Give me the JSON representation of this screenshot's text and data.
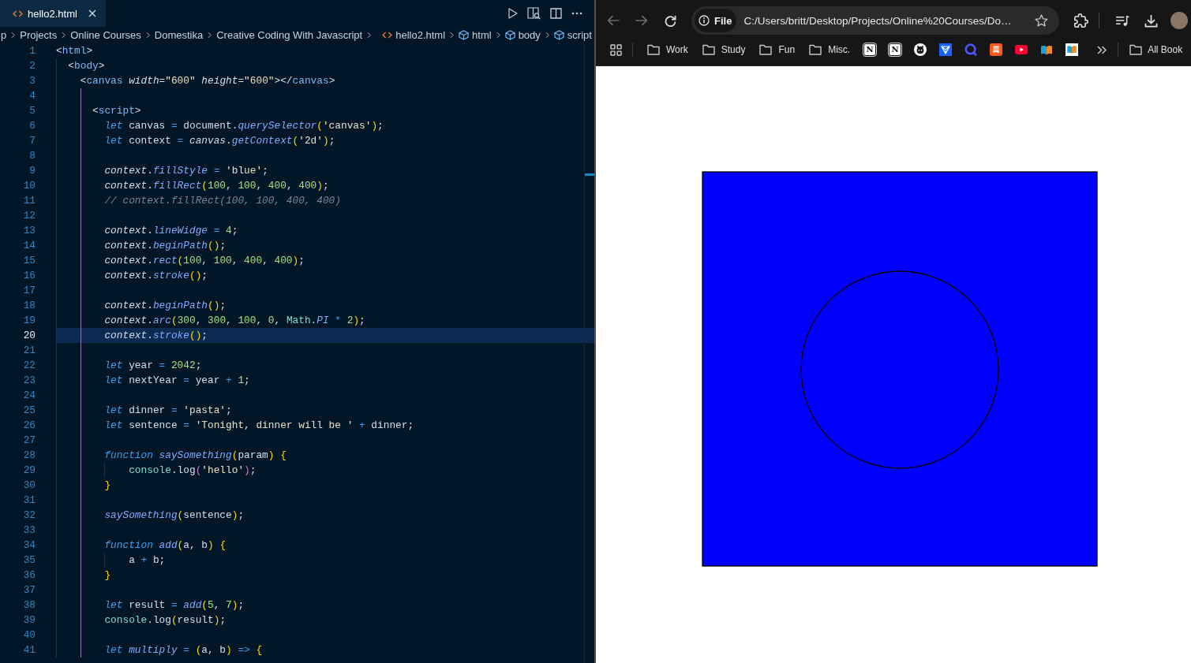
{
  "editor": {
    "tabs": [
      {
        "label": "hello2.html",
        "selected": true
      }
    ],
    "breadcrumbs": [
      {
        "kind": "folder",
        "label": "p"
      },
      {
        "kind": "folder",
        "label": "Projects"
      },
      {
        "kind": "folder",
        "label": "Online Courses"
      },
      {
        "kind": "folder",
        "label": "Domestika"
      },
      {
        "kind": "folder",
        "label": "Creative Coding With Javascript"
      },
      {
        "kind": "file",
        "label": "hello2.html"
      },
      {
        "kind": "symbol",
        "label": "html"
      },
      {
        "kind": "symbol",
        "label": "body"
      },
      {
        "kind": "symbol",
        "label": "script"
      }
    ],
    "lines": [
      {
        "number": "1",
        "current": false,
        "tokens": [
          {
            "kind": "text",
            "text": "<"
          },
          {
            "kind": "tag",
            "text": "html"
          },
          {
            "kind": "text",
            "text": ">"
          }
        ]
      },
      {
        "number": "2",
        "current": false,
        "tokens": [
          {
            "kind": "text",
            "text": "  <"
          },
          {
            "kind": "tag",
            "text": "body"
          },
          {
            "kind": "text",
            "text": ">"
          }
        ]
      },
      {
        "number": "3",
        "current": false,
        "tokens": [
          {
            "kind": "text",
            "text": "    <"
          },
          {
            "kind": "tag",
            "text": "canvas "
          },
          {
            "kind": "prop",
            "text": "width"
          },
          {
            "kind": "text",
            "text": "="
          },
          {
            "kind": "str",
            "text": "\"600\" "
          },
          {
            "kind": "prop",
            "text": "height"
          },
          {
            "kind": "text",
            "text": "="
          },
          {
            "kind": "str",
            "text": "\"600\""
          },
          {
            "kind": "text",
            "text": "></"
          },
          {
            "kind": "tag",
            "text": "canvas"
          },
          {
            "kind": "text",
            "text": ">"
          }
        ]
      },
      {
        "number": "4",
        "current": false
      },
      {
        "number": "5",
        "current": false,
        "tokens": [
          {
            "kind": "text",
            "text": "      <"
          },
          {
            "kind": "tag",
            "text": "script"
          },
          {
            "kind": "text",
            "text": ">"
          }
        ]
      },
      {
        "number": "6",
        "current": false,
        "tokens": [
          {
            "kind": "kw",
            "text": "        let"
          },
          {
            "kind": "text",
            "text": " canvas "
          },
          {
            "kind": "op",
            "text": "="
          },
          {
            "kind": "text",
            "text": " document."
          },
          {
            "kind": "fn",
            "text": "querySelector"
          },
          {
            "kind": "br",
            "text": "("
          },
          {
            "kind": "str",
            "text": "'canvas'"
          },
          {
            "kind": "br",
            "text": ")"
          },
          {
            "kind": "text",
            "text": ";"
          }
        ]
      },
      {
        "number": "7",
        "current": false,
        "tokens": [
          {
            "kind": "kw",
            "text": "        let"
          },
          {
            "kind": "text",
            "text": " context "
          },
          {
            "kind": "op",
            "text": "="
          },
          {
            "kind": "prop",
            "text": " canvas"
          },
          {
            "kind": "text",
            "text": "."
          },
          {
            "kind": "fn",
            "text": "getContext"
          },
          {
            "kind": "br",
            "text": "("
          },
          {
            "kind": "str",
            "text": "'2d'"
          },
          {
            "kind": "br",
            "text": ")"
          },
          {
            "kind": "text",
            "text": ";"
          }
        ]
      },
      {
        "number": "8",
        "current": false
      },
      {
        "number": "9",
        "current": false,
        "tokens": [
          {
            "kind": "prop",
            "text": "        context"
          },
          {
            "kind": "text",
            "text": "."
          },
          {
            "kind": "fn",
            "text": "fillStyle "
          },
          {
            "kind": "op",
            "text": "="
          },
          {
            "kind": "str",
            "text": " 'blue'"
          },
          {
            "kind": "text",
            "text": ";"
          }
        ]
      },
      {
        "number": "10",
        "current": false,
        "tokens": [
          {
            "kind": "prop",
            "text": "        context"
          },
          {
            "kind": "text",
            "text": "."
          },
          {
            "kind": "fn",
            "text": "fillRect"
          },
          {
            "kind": "br",
            "text": "("
          },
          {
            "kind": "num",
            "text": "100"
          },
          {
            "kind": "text",
            "text": ", "
          },
          {
            "kind": "num",
            "text": "100"
          },
          {
            "kind": "text",
            "text": ", "
          },
          {
            "kind": "num",
            "text": "400"
          },
          {
            "kind": "text",
            "text": ", "
          },
          {
            "kind": "num",
            "text": "400"
          },
          {
            "kind": "br",
            "text": ")"
          },
          {
            "kind": "text",
            "text": ";"
          }
        ]
      },
      {
        "number": "11",
        "current": false,
        "tokens": [
          {
            "kind": "cmt",
            "text": "        // context.fillRect(100, 100, 400, 400)"
          }
        ]
      },
      {
        "number": "12",
        "current": false
      },
      {
        "number": "13",
        "current": false,
        "tokens": [
          {
            "kind": "prop",
            "text": "        context"
          },
          {
            "kind": "text",
            "text": "."
          },
          {
            "kind": "fn",
            "text": "lineWidge "
          },
          {
            "kind": "op",
            "text": "="
          },
          {
            "kind": "num",
            "text": " 4"
          },
          {
            "kind": "text",
            "text": ";"
          }
        ]
      },
      {
        "number": "14",
        "current": false,
        "tokens": [
          {
            "kind": "prop",
            "text": "        context"
          },
          {
            "kind": "text",
            "text": "."
          },
          {
            "kind": "fn",
            "text": "beginPath"
          },
          {
            "kind": "br",
            "text": "()"
          },
          {
            "kind": "text",
            "text": ";"
          }
        ]
      },
      {
        "number": "15",
        "current": false,
        "tokens": [
          {
            "kind": "prop",
            "text": "        context"
          },
          {
            "kind": "text",
            "text": "."
          },
          {
            "kind": "fn",
            "text": "rect"
          },
          {
            "kind": "br",
            "text": "("
          },
          {
            "kind": "num",
            "text": "100"
          },
          {
            "kind": "text",
            "text": ", "
          },
          {
            "kind": "num",
            "text": "100"
          },
          {
            "kind": "text",
            "text": ", "
          },
          {
            "kind": "num",
            "text": "400"
          },
          {
            "kind": "text",
            "text": ", "
          },
          {
            "kind": "num",
            "text": "400"
          },
          {
            "kind": "br",
            "text": ")"
          },
          {
            "kind": "text",
            "text": ";"
          }
        ]
      },
      {
        "number": "16",
        "current": false,
        "tokens": [
          {
            "kind": "prop",
            "text": "        context"
          },
          {
            "kind": "text",
            "text": "."
          },
          {
            "kind": "fn",
            "text": "stroke"
          },
          {
            "kind": "br",
            "text": "()"
          },
          {
            "kind": "text",
            "text": ";"
          }
        ]
      },
      {
        "number": "17",
        "current": false
      },
      {
        "number": "18",
        "current": false,
        "tokens": [
          {
            "kind": "prop",
            "text": "        context"
          },
          {
            "kind": "text",
            "text": "."
          },
          {
            "kind": "fn",
            "text": "beginPath"
          },
          {
            "kind": "br",
            "text": "()"
          },
          {
            "kind": "text",
            "text": ";"
          }
        ]
      },
      {
        "number": "19",
        "current": false,
        "tokens": [
          {
            "kind": "prop",
            "text": "        context"
          },
          {
            "kind": "text",
            "text": "."
          },
          {
            "kind": "fn",
            "text": "arc"
          },
          {
            "kind": "br",
            "text": "("
          },
          {
            "kind": "num",
            "text": "300"
          },
          {
            "kind": "text",
            "text": ", "
          },
          {
            "kind": "num",
            "text": "300"
          },
          {
            "kind": "text",
            "text": ", "
          },
          {
            "kind": "num",
            "text": "100"
          },
          {
            "kind": "text",
            "text": ", "
          },
          {
            "kind": "num",
            "text": "0"
          },
          {
            "kind": "text",
            "text": ", "
          },
          {
            "kind": "obj",
            "text": "Math"
          },
          {
            "kind": "text",
            "text": "."
          },
          {
            "kind": "fn",
            "text": "PI "
          },
          {
            "kind": "op",
            "text": "*"
          },
          {
            "kind": "num",
            "text": " 2"
          },
          {
            "kind": "br",
            "text": ")"
          },
          {
            "kind": "text",
            "text": ";"
          }
        ]
      },
      {
        "number": "20",
        "current": true,
        "tokens": [
          {
            "kind": "prop",
            "text": "        context"
          },
          {
            "kind": "text",
            "text": "."
          },
          {
            "kind": "fn",
            "text": "stroke"
          },
          {
            "kind": "br",
            "text": "()"
          },
          {
            "kind": "text",
            "text": ";"
          }
        ]
      },
      {
        "number": "21",
        "current": false
      },
      {
        "number": "22",
        "current": false,
        "tokens": [
          {
            "kind": "kw",
            "text": "        let"
          },
          {
            "kind": "text",
            "text": " year "
          },
          {
            "kind": "op",
            "text": "="
          },
          {
            "kind": "num",
            "text": " 2042"
          },
          {
            "kind": "text",
            "text": ";"
          }
        ]
      },
      {
        "number": "23",
        "current": false,
        "tokens": [
          {
            "kind": "kw",
            "text": "        let"
          },
          {
            "kind": "text",
            "text": " nextYear "
          },
          {
            "kind": "op",
            "text": "="
          },
          {
            "kind": "text",
            "text": " year "
          },
          {
            "kind": "op",
            "text": "+"
          },
          {
            "kind": "num",
            "text": " 1"
          },
          {
            "kind": "text",
            "text": ";"
          }
        ]
      },
      {
        "number": "24",
        "current": false
      },
      {
        "number": "25",
        "current": false,
        "tokens": [
          {
            "kind": "kw",
            "text": "        let"
          },
          {
            "kind": "text",
            "text": " dinner "
          },
          {
            "kind": "op",
            "text": "="
          },
          {
            "kind": "str",
            "text": " 'pasta'"
          },
          {
            "kind": "text",
            "text": ";"
          }
        ]
      },
      {
        "number": "26",
        "current": false,
        "tokens": [
          {
            "kind": "kw",
            "text": "        let"
          },
          {
            "kind": "text",
            "text": " sentence "
          },
          {
            "kind": "op",
            "text": "="
          },
          {
            "kind": "str",
            "text": " 'Tonight, dinner will be ' "
          },
          {
            "kind": "op",
            "text": "+"
          },
          {
            "kind": "text",
            "text": " dinner;"
          }
        ]
      },
      {
        "number": "27",
        "current": false
      },
      {
        "number": "28",
        "current": false,
        "tokens": [
          {
            "kind": "kw",
            "text": "        function "
          },
          {
            "kind": "fn",
            "text": "saySomething"
          },
          {
            "kind": "br",
            "text": "("
          },
          {
            "kind": "text",
            "text": "param"
          },
          {
            "kind": "br",
            "text": ")"
          },
          {
            "kind": "br",
            "text": " {"
          }
        ]
      },
      {
        "number": "29",
        "current": false,
        "tokens": [
          {
            "kind": "obj",
            "text": "            console"
          },
          {
            "kind": "text",
            "text": ".log"
          },
          {
            "kind": "br2",
            "text": "("
          },
          {
            "kind": "str",
            "text": "'hello'"
          },
          {
            "kind": "br2",
            "text": ")"
          },
          {
            "kind": "text",
            "text": ";"
          }
        ]
      },
      {
        "number": "30",
        "current": false,
        "tokens": [
          {
            "kind": "br",
            "text": "        }"
          }
        ]
      },
      {
        "number": "31",
        "current": false
      },
      {
        "number": "32",
        "current": false,
        "tokens": [
          {
            "kind": "fn",
            "text": "        saySomething"
          },
          {
            "kind": "br",
            "text": "("
          },
          {
            "kind": "text",
            "text": "sentence"
          },
          {
            "kind": "br",
            "text": ")"
          },
          {
            "kind": "text",
            "text": ";"
          }
        ]
      },
      {
        "number": "33",
        "current": false
      },
      {
        "number": "34",
        "current": false,
        "tokens": [
          {
            "kind": "kw",
            "text": "        function "
          },
          {
            "kind": "fn",
            "text": "add"
          },
          {
            "kind": "br",
            "text": "("
          },
          {
            "kind": "text",
            "text": "a, b"
          },
          {
            "kind": "br",
            "text": ")"
          },
          {
            "kind": "br",
            "text": " {"
          }
        ]
      },
      {
        "number": "35",
        "current": false,
        "tokens": [
          {
            "kind": "text",
            "text": "            a "
          },
          {
            "kind": "op",
            "text": "+"
          },
          {
            "kind": "text",
            "text": " b;"
          }
        ]
      },
      {
        "number": "36",
        "current": false,
        "tokens": [
          {
            "kind": "br",
            "text": "        }"
          }
        ]
      },
      {
        "number": "37",
        "current": false
      },
      {
        "number": "38",
        "current": false,
        "tokens": [
          {
            "kind": "kw",
            "text": "        let"
          },
          {
            "kind": "text",
            "text": " result "
          },
          {
            "kind": "op",
            "text": "="
          },
          {
            "kind": "fn",
            "text": " add"
          },
          {
            "kind": "br",
            "text": "("
          },
          {
            "kind": "num",
            "text": "5"
          },
          {
            "kind": "text",
            "text": ", "
          },
          {
            "kind": "num",
            "text": "7"
          },
          {
            "kind": "br",
            "text": ")"
          },
          {
            "kind": "text",
            "text": ";"
          }
        ]
      },
      {
        "number": "39",
        "current": false,
        "tokens": [
          {
            "kind": "obj",
            "text": "        console"
          },
          {
            "kind": "text",
            "text": ".log"
          },
          {
            "kind": "br",
            "text": "("
          },
          {
            "kind": "text",
            "text": "result"
          },
          {
            "kind": "br",
            "text": ")"
          },
          {
            "kind": "text",
            "text": ";"
          }
        ]
      },
      {
        "number": "40",
        "current": false
      },
      {
        "number": "41",
        "current": false,
        "tokens": [
          {
            "kind": "kw",
            "text": "        let "
          },
          {
            "kind": "fn",
            "text": "multiply "
          },
          {
            "kind": "op",
            "text": "="
          },
          {
            "kind": "br",
            "text": " ("
          },
          {
            "kind": "text",
            "text": "a, b"
          },
          {
            "kind": "br",
            "text": ")"
          },
          {
            "kind": "op",
            "text": " =>"
          },
          {
            "kind": "br",
            "text": " {"
          }
        ]
      }
    ]
  },
  "browser": {
    "nav_buttons": [
      {
        "kind": "back",
        "disabled": true
      },
      {
        "kind": "forward",
        "disabled": true
      },
      {
        "kind": "reload",
        "disabled": false
      }
    ],
    "address_bar": {
      "scheme_chip": "File",
      "url": "C:/Users/britt/Desktop/Projects/Online%20Courses/Do…"
    },
    "bookmarks": [
      {
        "kind": "folder",
        "label": "Work"
      },
      {
        "kind": "folder",
        "label": "Study"
      },
      {
        "kind": "folder",
        "label": "Fun"
      },
      {
        "kind": "folder",
        "label": "Misc."
      },
      {
        "kind": "letter",
        "glyph": "N"
      },
      {
        "kind": "letter",
        "glyph": "N"
      },
      {
        "kind": "cat"
      },
      {
        "kind": "gem"
      },
      {
        "kind": "ring"
      },
      {
        "kind": "ribbon"
      },
      {
        "kind": "play"
      },
      {
        "kind": "book"
      },
      {
        "kind": "booktile"
      }
    ],
    "other_bookmarks": {
      "label": "All Book"
    },
    "page": {
      "shapes": [
        {
          "kind": "square"
        },
        {
          "kind": "circle"
        }
      ]
    }
  }
}
